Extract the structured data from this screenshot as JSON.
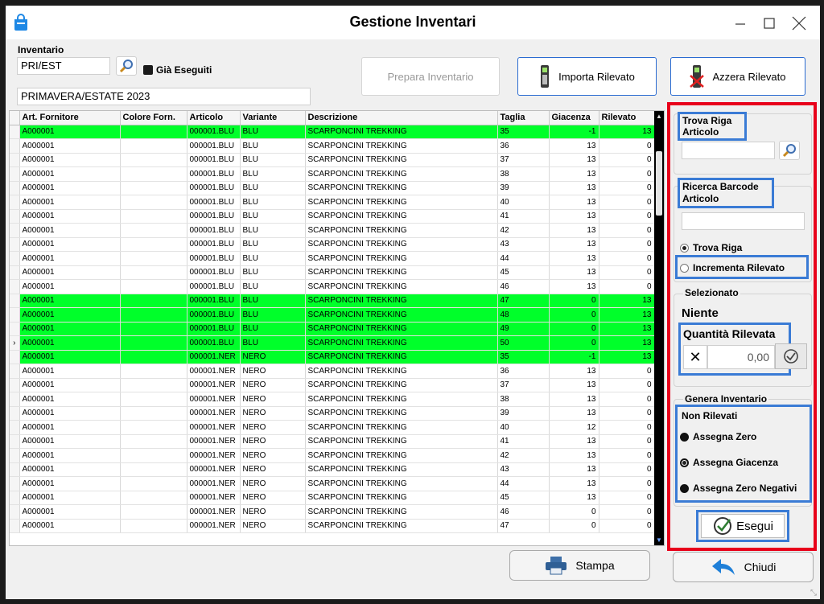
{
  "window": {
    "title": "Gestione Inventari",
    "icon": "shopping-bag-icon"
  },
  "header": {
    "inventario_label": "Inventario",
    "inventario_code": "PRI/EST",
    "gia_eseguiti_label": "Già Eseguiti",
    "inventario_desc": "PRIMAVERA/ESTATE 2023",
    "prepara_label": "Prepara Inventario",
    "importa_label": "Importa Rilevato",
    "azzera_label": "Azzera Rilevato"
  },
  "grid": {
    "columns": [
      "Art. Fornitore",
      "Colore Forn.",
      "Articolo",
      "Variante",
      "Descrizione",
      "Taglia",
      "Giacenza",
      "Rilevato"
    ],
    "rows": [
      {
        "af": "A000001",
        "cf": "",
        "art": "000001.BLU",
        "var": "BLU",
        "desc": "SCARPONCINI TREKKING",
        "tg": "35",
        "gia": "-1",
        "ril": "13",
        "hl": true,
        "cur": false
      },
      {
        "af": "A000001",
        "cf": "",
        "art": "000001.BLU",
        "var": "BLU",
        "desc": "SCARPONCINI TREKKING",
        "tg": "36",
        "gia": "13",
        "ril": "0",
        "hl": false,
        "cur": false
      },
      {
        "af": "A000001",
        "cf": "",
        "art": "000001.BLU",
        "var": "BLU",
        "desc": "SCARPONCINI TREKKING",
        "tg": "37",
        "gia": "13",
        "ril": "0",
        "hl": false,
        "cur": false
      },
      {
        "af": "A000001",
        "cf": "",
        "art": "000001.BLU",
        "var": "BLU",
        "desc": "SCARPONCINI TREKKING",
        "tg": "38",
        "gia": "13",
        "ril": "0",
        "hl": false,
        "cur": false
      },
      {
        "af": "A000001",
        "cf": "",
        "art": "000001.BLU",
        "var": "BLU",
        "desc": "SCARPONCINI TREKKING",
        "tg": "39",
        "gia": "13",
        "ril": "0",
        "hl": false,
        "cur": false
      },
      {
        "af": "A000001",
        "cf": "",
        "art": "000001.BLU",
        "var": "BLU",
        "desc": "SCARPONCINI TREKKING",
        "tg": "40",
        "gia": "13",
        "ril": "0",
        "hl": false,
        "cur": false
      },
      {
        "af": "A000001",
        "cf": "",
        "art": "000001.BLU",
        "var": "BLU",
        "desc": "SCARPONCINI TREKKING",
        "tg": "41",
        "gia": "13",
        "ril": "0",
        "hl": false,
        "cur": false
      },
      {
        "af": "A000001",
        "cf": "",
        "art": "000001.BLU",
        "var": "BLU",
        "desc": "SCARPONCINI TREKKING",
        "tg": "42",
        "gia": "13",
        "ril": "0",
        "hl": false,
        "cur": false
      },
      {
        "af": "A000001",
        "cf": "",
        "art": "000001.BLU",
        "var": "BLU",
        "desc": "SCARPONCINI TREKKING",
        "tg": "43",
        "gia": "13",
        "ril": "0",
        "hl": false,
        "cur": false
      },
      {
        "af": "A000001",
        "cf": "",
        "art": "000001.BLU",
        "var": "BLU",
        "desc": "SCARPONCINI TREKKING",
        "tg": "44",
        "gia": "13",
        "ril": "0",
        "hl": false,
        "cur": false
      },
      {
        "af": "A000001",
        "cf": "",
        "art": "000001.BLU",
        "var": "BLU",
        "desc": "SCARPONCINI TREKKING",
        "tg": "45",
        "gia": "13",
        "ril": "0",
        "hl": false,
        "cur": false
      },
      {
        "af": "A000001",
        "cf": "",
        "art": "000001.BLU",
        "var": "BLU",
        "desc": "SCARPONCINI TREKKING",
        "tg": "46",
        "gia": "13",
        "ril": "0",
        "hl": false,
        "cur": false
      },
      {
        "af": "A000001",
        "cf": "",
        "art": "000001.BLU",
        "var": "BLU",
        "desc": "SCARPONCINI TREKKING",
        "tg": "47",
        "gia": "0",
        "ril": "13",
        "hl": true,
        "cur": false
      },
      {
        "af": "A000001",
        "cf": "",
        "art": "000001.BLU",
        "var": "BLU",
        "desc": "SCARPONCINI TREKKING",
        "tg": "48",
        "gia": "0",
        "ril": "13",
        "hl": true,
        "cur": false
      },
      {
        "af": "A000001",
        "cf": "",
        "art": "000001.BLU",
        "var": "BLU",
        "desc": "SCARPONCINI TREKKING",
        "tg": "49",
        "gia": "0",
        "ril": "13",
        "hl": true,
        "cur": false
      },
      {
        "af": "A000001",
        "cf": "",
        "art": "000001.BLU",
        "var": "BLU",
        "desc": "SCARPONCINI TREKKING",
        "tg": "50",
        "gia": "0",
        "ril": "13",
        "hl": true,
        "cur": true
      },
      {
        "af": "A000001",
        "cf": "",
        "art": "000001.NER",
        "var": "NERO",
        "desc": "SCARPONCINI TREKKING",
        "tg": "35",
        "gia": "-1",
        "ril": "13",
        "hl": true,
        "cur": false
      },
      {
        "af": "A000001",
        "cf": "",
        "art": "000001.NER",
        "var": "NERO",
        "desc": "SCARPONCINI TREKKING",
        "tg": "36",
        "gia": "13",
        "ril": "0",
        "hl": false,
        "cur": false
      },
      {
        "af": "A000001",
        "cf": "",
        "art": "000001.NER",
        "var": "NERO",
        "desc": "SCARPONCINI TREKKING",
        "tg": "37",
        "gia": "13",
        "ril": "0",
        "hl": false,
        "cur": false
      },
      {
        "af": "A000001",
        "cf": "",
        "art": "000001.NER",
        "var": "NERO",
        "desc": "SCARPONCINI TREKKING",
        "tg": "38",
        "gia": "13",
        "ril": "0",
        "hl": false,
        "cur": false
      },
      {
        "af": "A000001",
        "cf": "",
        "art": "000001.NER",
        "var": "NERO",
        "desc": "SCARPONCINI TREKKING",
        "tg": "39",
        "gia": "13",
        "ril": "0",
        "hl": false,
        "cur": false
      },
      {
        "af": "A000001",
        "cf": "",
        "art": "000001.NER",
        "var": "NERO",
        "desc": "SCARPONCINI TREKKING",
        "tg": "40",
        "gia": "12",
        "ril": "0",
        "hl": false,
        "cur": false
      },
      {
        "af": "A000001",
        "cf": "",
        "art": "000001.NER",
        "var": "NERO",
        "desc": "SCARPONCINI TREKKING",
        "tg": "41",
        "gia": "13",
        "ril": "0",
        "hl": false,
        "cur": false
      },
      {
        "af": "A000001",
        "cf": "",
        "art": "000001.NER",
        "var": "NERO",
        "desc": "SCARPONCINI TREKKING",
        "tg": "42",
        "gia": "13",
        "ril": "0",
        "hl": false,
        "cur": false
      },
      {
        "af": "A000001",
        "cf": "",
        "art": "000001.NER",
        "var": "NERO",
        "desc": "SCARPONCINI TREKKING",
        "tg": "43",
        "gia": "13",
        "ril": "0",
        "hl": false,
        "cur": false
      },
      {
        "af": "A000001",
        "cf": "",
        "art": "000001.NER",
        "var": "NERO",
        "desc": "SCARPONCINI TREKKING",
        "tg": "44",
        "gia": "13",
        "ril": "0",
        "hl": false,
        "cur": false
      },
      {
        "af": "A000001",
        "cf": "",
        "art": "000001.NER",
        "var": "NERO",
        "desc": "SCARPONCINI TREKKING",
        "tg": "45",
        "gia": "13",
        "ril": "0",
        "hl": false,
        "cur": false
      },
      {
        "af": "A000001",
        "cf": "",
        "art": "000001.NER",
        "var": "NERO",
        "desc": "SCARPONCINI TREKKING",
        "tg": "46",
        "gia": "0",
        "ril": "0",
        "hl": false,
        "cur": false
      },
      {
        "af": "A000001",
        "cf": "",
        "art": "000001.NER",
        "var": "NERO",
        "desc": "SCARPONCINI TREKKING",
        "tg": "47",
        "gia": "0",
        "ril": "0",
        "hl": false,
        "cur": false
      }
    ]
  },
  "side": {
    "trova_riga_title": "Trova Riga Articolo",
    "ricerca_barcode_title": "Ricerca Barcode Articolo",
    "radio_trova": "Trova Riga",
    "radio_incrementa": "Incrementa Rilevato",
    "selezionato_title": "Selezionato",
    "selezionato_value": "Niente",
    "quantita_label": "Quantità Rilevata",
    "quantita_value": "0,00",
    "genera_title": "Genera Inventario",
    "non_rilevati_title": "Non Rilevati",
    "opt_zero": "Assegna Zero",
    "opt_giacenza": "Assegna Giacenza",
    "opt_zero_negativi": "Assegna Zero Negativi",
    "esegui_label": "Esegui"
  },
  "footer": {
    "stampa_label": "Stampa",
    "chiudi_label": "Chiudi"
  },
  "colors": {
    "highlight_row": "#00ff2a",
    "annotation_red": "#e8001a",
    "annotation_blue": "#3a7bd5"
  }
}
